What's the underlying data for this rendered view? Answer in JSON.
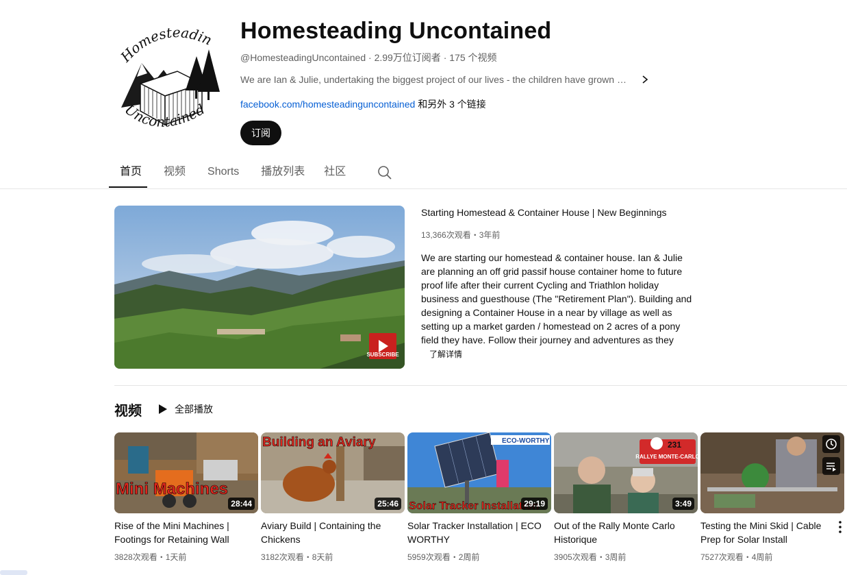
{
  "channel": {
    "name": "Homesteading Uncontained",
    "handle": "@HomesteadingUncontained",
    "subscribers": "2.99万位订阅者",
    "video_count": "175 个视频",
    "description": "We are Ian & Julie, undertaking the biggest project of our lives - the children have grown up and moved on...",
    "link_url": "facebook.com/homesteadinguncontained",
    "link_more": "和另外 3 个链接",
    "subscribe_label": "订阅",
    "logo_text_top": "Homesteading",
    "logo_text_bottom": "Uncontained"
  },
  "tabs": [
    {
      "label": "首页",
      "active": true
    },
    {
      "label": "视频",
      "active": false
    },
    {
      "label": "Shorts",
      "active": false
    },
    {
      "label": "播放列表",
      "active": false
    },
    {
      "label": "社区",
      "active": false
    }
  ],
  "featured": {
    "title": "Starting Homestead & Container House | New Beginnings",
    "views": "13,366次观看",
    "age": "3年前",
    "description": "We are starting our homestead & container house.  Ian & Julie are planning an off grid passif house container home to future proof life after their current  Cycling and Triathlon holiday business and guesthouse (The \"Retirement Plan\"). Building and designing a Container House in a near by village as well as setting up a market garden / homestead on 2 acres of a pony field they have. Follow their journey and adventures as they will…",
    "more_label": "了解详情",
    "subscribe_badge": "SUBSCRIBE"
  },
  "videos_section": {
    "title": "视频",
    "play_all": "全部播放",
    "items": [
      {
        "title": "Rise of the Mini Machines | Footings for Retaining Wall",
        "duration": "28:44",
        "views": "3828次观看",
        "age": "1天前",
        "overlay": "Mini Machines"
      },
      {
        "title": "Aviary Build | Containing the Chickens",
        "duration": "25:46",
        "views": "3182次观看",
        "age": "8天前",
        "overlay": "Building an Aviary"
      },
      {
        "title": "Solar Tracker Installation | ECO WORTHY",
        "duration": "29:19",
        "views": "5959次观看",
        "age": "2周前",
        "overlay": "Solar Tracker Installation",
        "brand": "ECO-WORTHY"
      },
      {
        "title": "Out of the Rally Monte Carlo Historique",
        "duration": "3:49",
        "views": "3905次观看",
        "age": "3周前",
        "overlay_top": "231",
        "overlay": "RALLYE MONTE-CARLO"
      },
      {
        "title": "Testing the Mini Skid | Cable Prep for Solar Install",
        "duration": "",
        "views": "7527次观看",
        "age": "4周前"
      }
    ]
  },
  "separator": "・",
  "colors": {
    "link": "#065fd4",
    "text": "#0f0f0f",
    "secondary": "#606060",
    "accent_red": "#e0261d"
  }
}
